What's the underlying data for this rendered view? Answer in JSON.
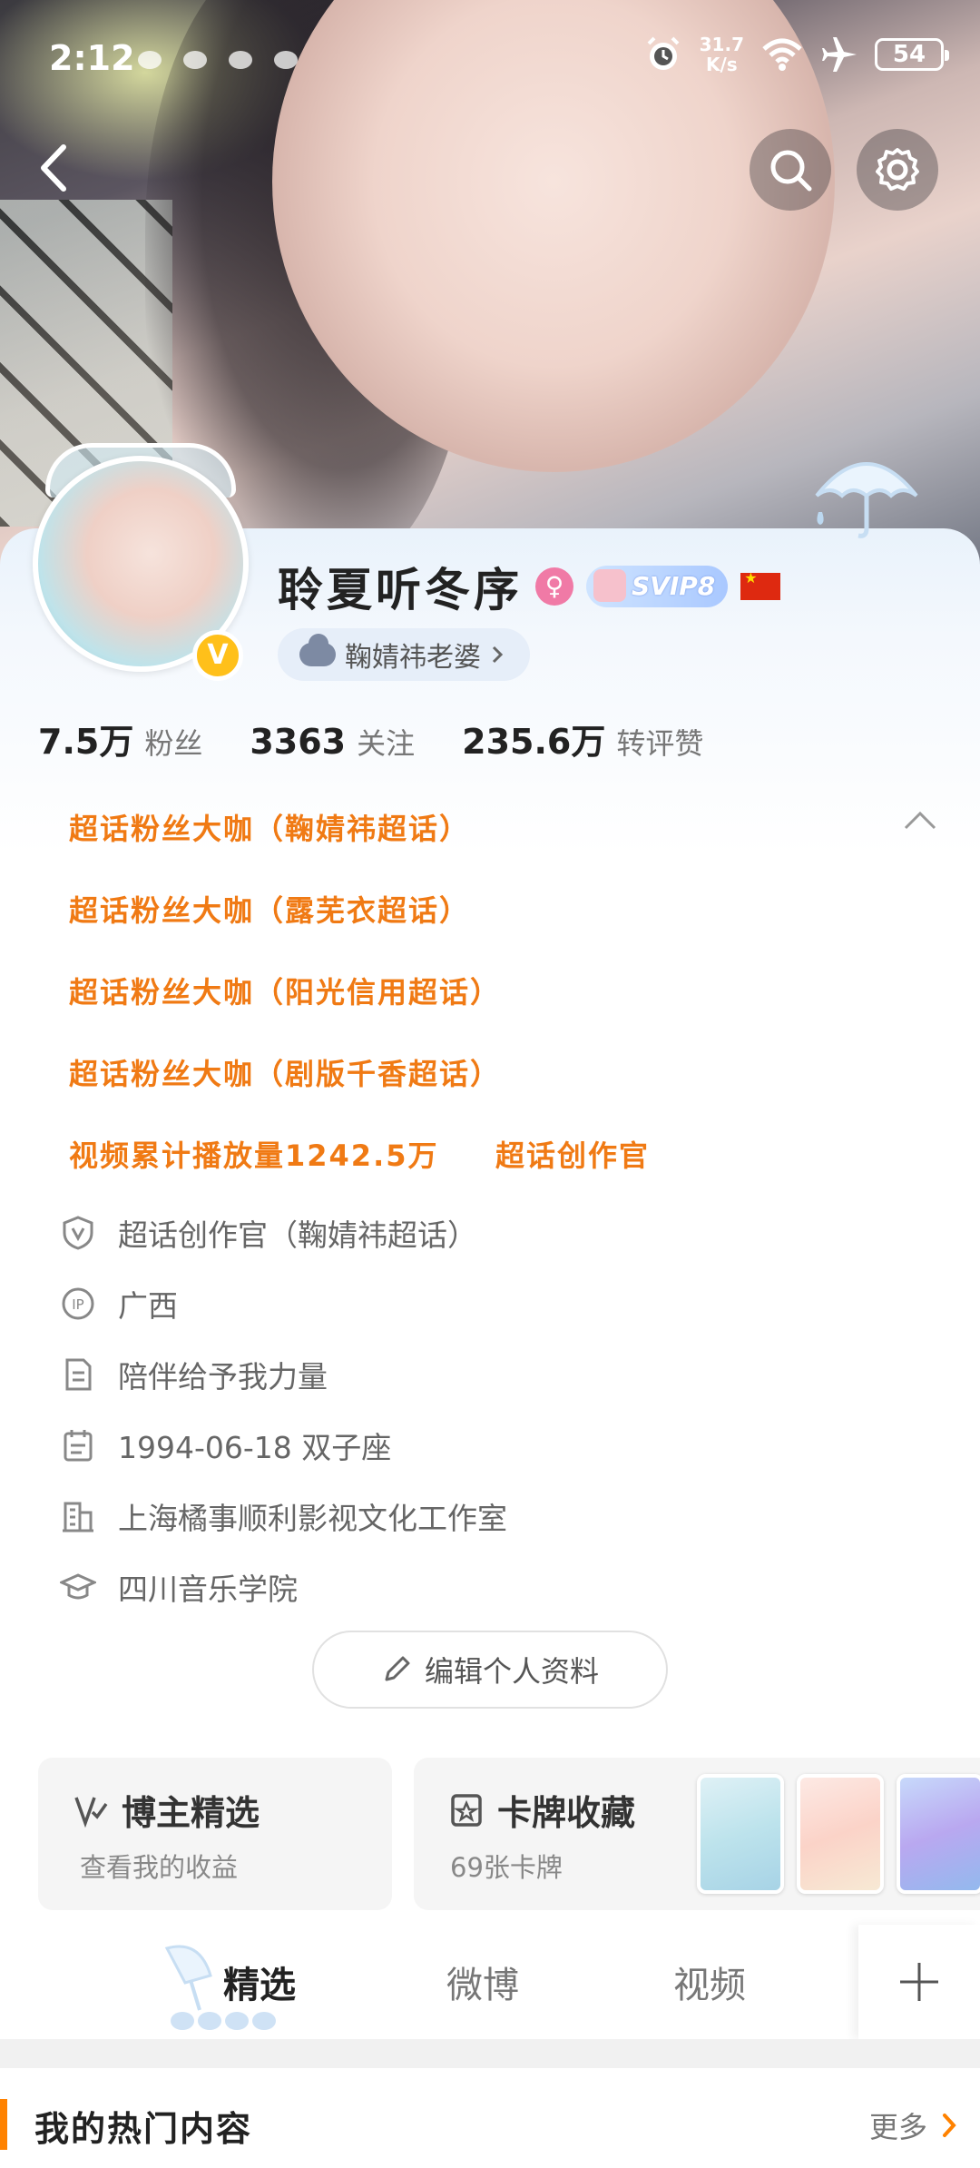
{
  "status_bar": {
    "time": "2:12",
    "net_speed_value": "31.7",
    "net_speed_unit": "K/s",
    "battery": "54"
  },
  "profile": {
    "username": "聆夏听冬序",
    "svip_label": "SVIP8",
    "supertopic_tag": "鞠婧祎老婆",
    "verified_badge": "V"
  },
  "stats": [
    {
      "value": "7.5万",
      "label": "粉丝"
    },
    {
      "value": "3363",
      "label": "关注"
    },
    {
      "value": "235.6万",
      "label": "转评赞"
    }
  ],
  "badges": [
    "超话粉丝大咖（鞠婧祎超话）",
    "超话粉丝大咖（露芜衣超话）",
    "超话粉丝大咖（阳光信用超话）",
    "超话粉丝大咖（剧版千香超话）"
  ],
  "video_badge": {
    "plays": "视频累计播放量1242.5万",
    "creator": "超话创作官"
  },
  "info": {
    "creator": "超话创作官（鞠婧祎超话）",
    "location": "广西",
    "bio": "陪伴给予我力量",
    "birthday": "1994-06-18 双子座",
    "company": "上海橘事顺利影视文化工作室",
    "school": "四川音乐学院"
  },
  "edit_button": "编辑个人资料",
  "features": {
    "blogger_title": "博主精选",
    "blogger_sub": "查看我的收益",
    "cards_title": "卡牌收藏",
    "cards_sub": "69张卡牌"
  },
  "tabs": [
    "精选",
    "微博",
    "视频"
  ],
  "hot_section": {
    "title": "我的热门内容",
    "more": "更多"
  },
  "colors": {
    "accent_orange": "#f07a14",
    "weibo_orange": "#ff8200",
    "vip_gold": "#ffc01a"
  },
  "icons": [
    "back-icon",
    "search-icon",
    "gear-icon",
    "shield-v-icon",
    "ip-icon",
    "document-icon",
    "calendar-icon",
    "building-icon",
    "graduation-cap-icon",
    "pencil-icon",
    "plus-icon",
    "chevron-up-icon",
    "chevron-right-icon"
  ]
}
